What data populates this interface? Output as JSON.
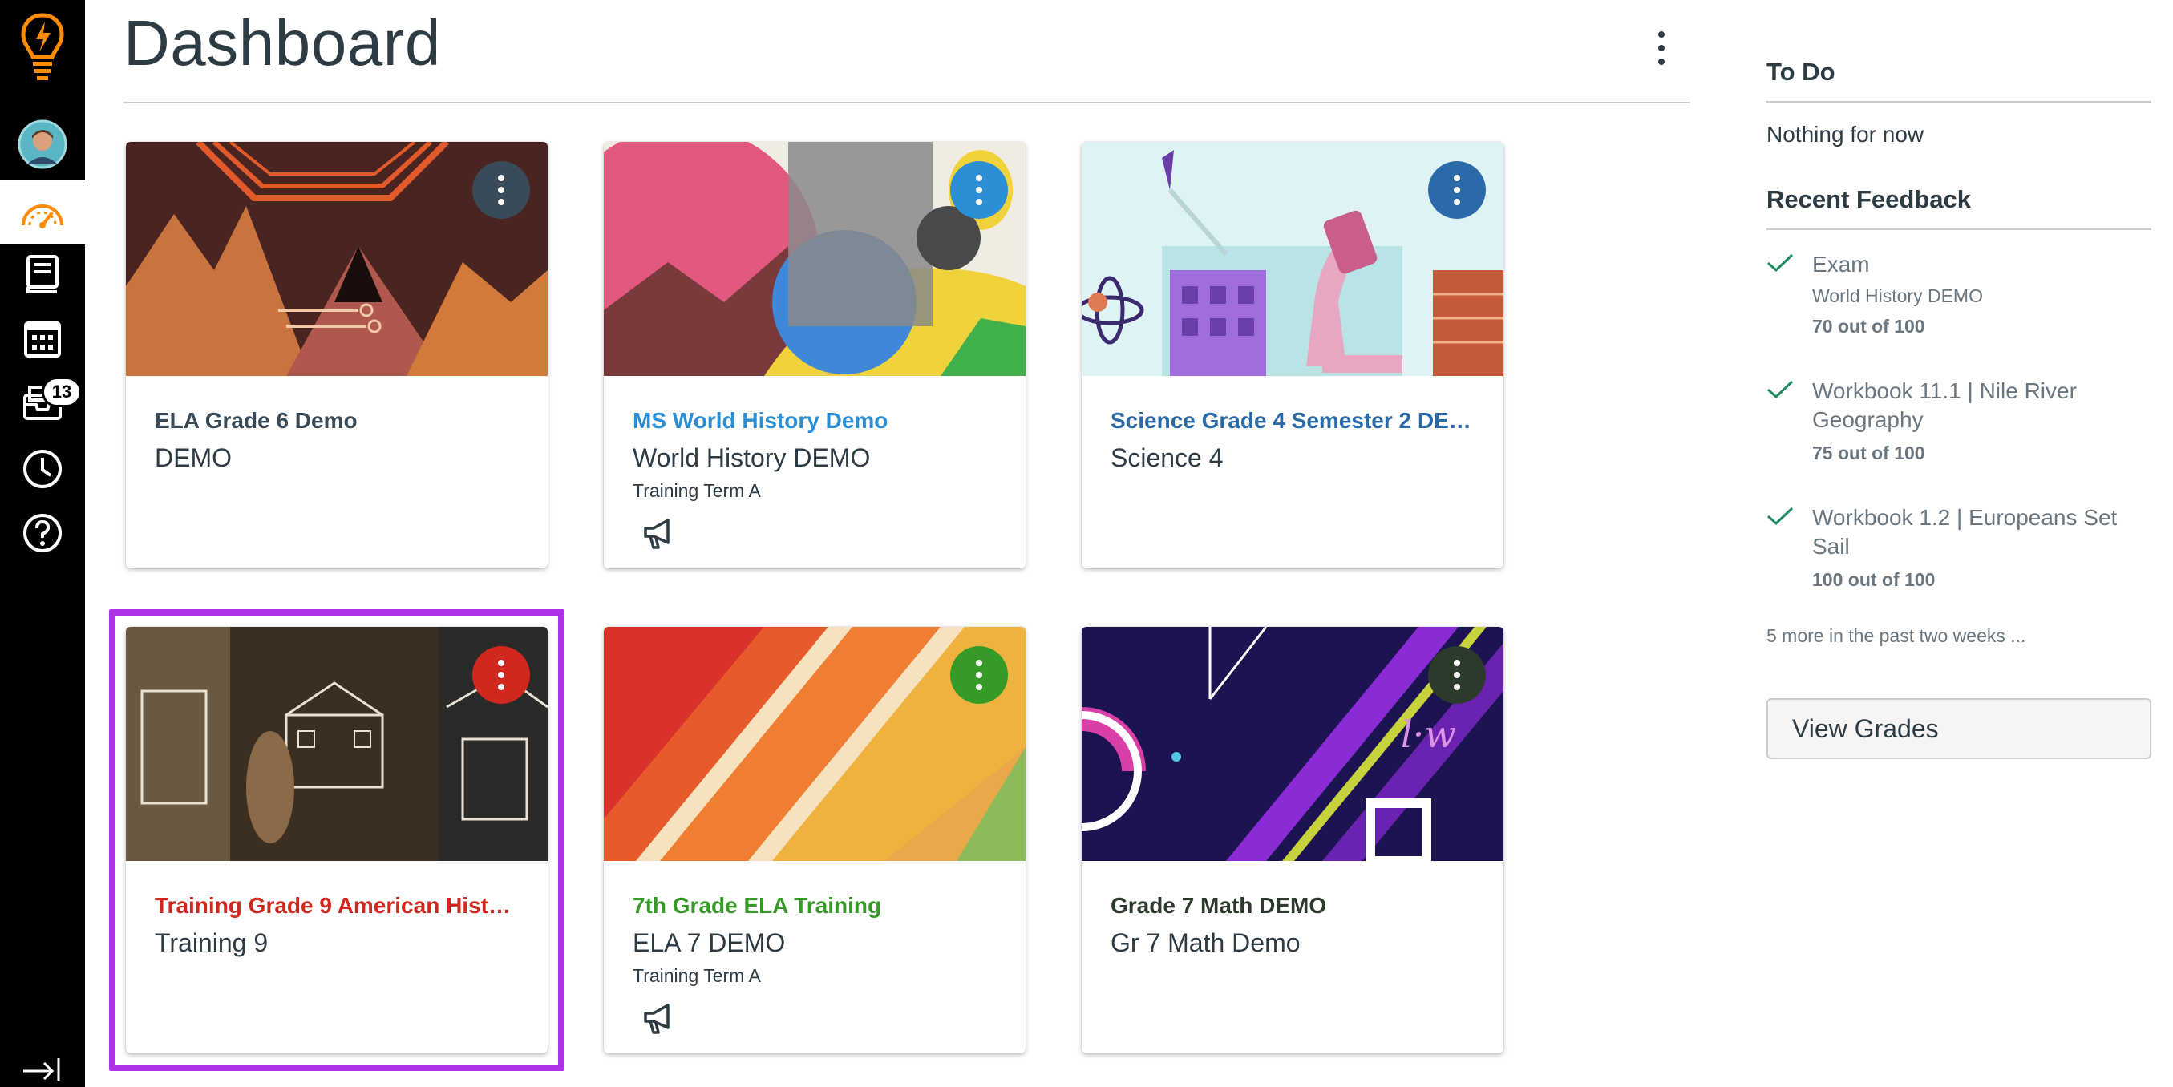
{
  "header": {
    "title": "Dashboard"
  },
  "nav": {
    "badge_count": "13"
  },
  "cards": [
    {
      "title": "ELA Grade 6 Demo",
      "code": "DEMO",
      "term": "",
      "color": "#394b58"
    },
    {
      "title": "MS World History Demo",
      "code": "World History DEMO",
      "term": "Training Term A",
      "color": "#2b8fd6"
    },
    {
      "title": "Science Grade 4 Semester 2 DEMO",
      "code": "Science 4",
      "term": "",
      "color": "#2a6aa8"
    },
    {
      "title": "Training Grade 9 American History...",
      "code": "Training 9",
      "term": "",
      "color": "#d0281f"
    },
    {
      "title": "7th Grade ELA Training",
      "code": "ELA 7 DEMO",
      "term": "Training Term A",
      "color": "#359b26"
    },
    {
      "title": "Grade 7 Math DEMO",
      "code": "Gr 7 Math Demo",
      "term": "",
      "color": "#2c3a2c"
    }
  ],
  "sidebar": {
    "todo_heading": "To Do",
    "todo_empty": "Nothing for now",
    "feedback_heading": "Recent Feedback",
    "feedback": [
      {
        "title": "Exam",
        "course": "World History DEMO",
        "score": "70 out of 100"
      },
      {
        "title": "Workbook 11.1 | Nile River Geography",
        "course": "",
        "score": "75 out of 100"
      },
      {
        "title": "Workbook 1.2 | Europeans Set Sail",
        "course": "",
        "score": "100 out of 100"
      }
    ],
    "more": "5 more in the past two weeks ...",
    "view_grades": "View Grades"
  },
  "colors": {
    "nav_bg": "#000000",
    "accent": "#ff8c00",
    "focus": "#ad33e8",
    "check": "#1d8a5f"
  },
  "icons": [
    "logo-icon",
    "avatar",
    "dashboard-icon",
    "courses-icon",
    "calendar-icon",
    "inbox-icon",
    "history-icon",
    "help-icon",
    "collapse-nav-icon",
    "announcement-icon",
    "checkmark-icon"
  ]
}
